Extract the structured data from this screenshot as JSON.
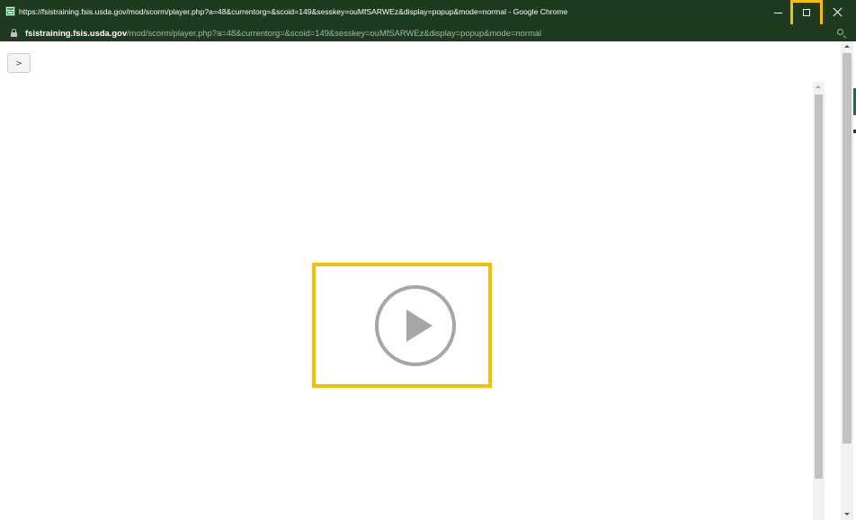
{
  "window": {
    "title": "https://fsistraining.fsis.usda.gov/mod/scorm/player.php?a=48&currentorg=&scoid=149&sesskey=ouMfSARWEz&display=popup&mode=normal - Google Chrome",
    "icon": "browser-window-icon",
    "controls": {
      "minimize_icon": "minimize-icon",
      "maximize_icon": "maximize-icon",
      "close_icon": "close-icon"
    },
    "highlight_color": "#f5c000",
    "titlebar_color": "#1e3a1f"
  },
  "addressbar": {
    "lock_icon": "lock-icon",
    "url_domain": "fsistraining.fsis.usda.gov",
    "url_path": "/mod/scorm/player.php?a=48&currentorg=&scoid=149&sesskey=ouMfSARWEz&display=popup&mode=normal",
    "zoom_icon": "zoom-icon"
  },
  "content": {
    "toggle_button_label": ">",
    "play_button_icon": "play-circle-icon"
  }
}
